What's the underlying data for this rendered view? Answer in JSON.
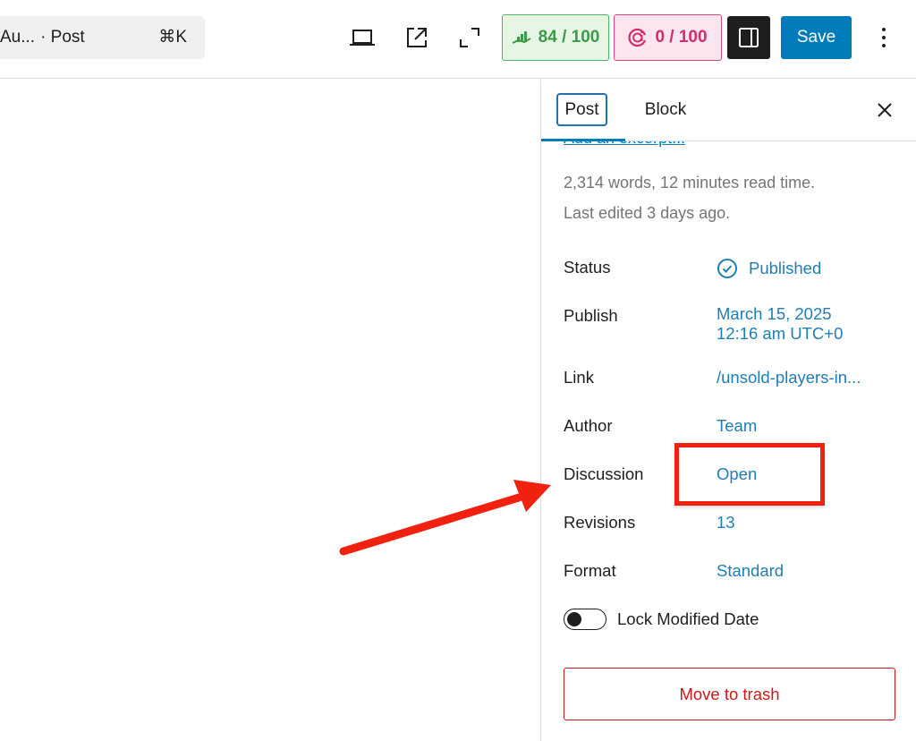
{
  "toolbar": {
    "command_title": "Au...",
    "command_type": "· Post",
    "command_shortcut": "⌘K",
    "icons": [
      "laptop-icon",
      "external-link-icon",
      "fullscreen-icon"
    ],
    "seo_score": "84 / 100",
    "ai_score": "0 / 100",
    "save_label": "Save",
    "colors": {
      "seo_green": "#3e9a4b",
      "ai_pink": "#d02e6a",
      "primary_blue": "#007cba"
    }
  },
  "sidebar": {
    "tabs": [
      {
        "label": "Post",
        "active": true
      },
      {
        "label": "Block",
        "active": false
      }
    ],
    "excerpt_link": "Add an excerpt...",
    "word_count": "2,314 words, 12 minutes read time.",
    "last_edited": "Last edited 3 days ago.",
    "fields": [
      {
        "label": "Status",
        "value": "Published"
      },
      {
        "label": "Publish",
        "value": "March 15, 2025",
        "value_line2": "12:16 am UTC+0"
      },
      {
        "label": "Link",
        "value": "/unsold-players-in..."
      },
      {
        "label": "Author",
        "value": "Team"
      },
      {
        "label": "Discussion",
        "value": "Open"
      },
      {
        "label": "Revisions",
        "value": "13"
      },
      {
        "label": "Format",
        "value": "Standard"
      }
    ],
    "lock_modified_date": {
      "label": "Lock Modified Date",
      "checked": false
    },
    "trash_label": "Move to trash"
  },
  "annotation": {
    "highlighted_field": "Discussion",
    "color": "#f0220f"
  }
}
